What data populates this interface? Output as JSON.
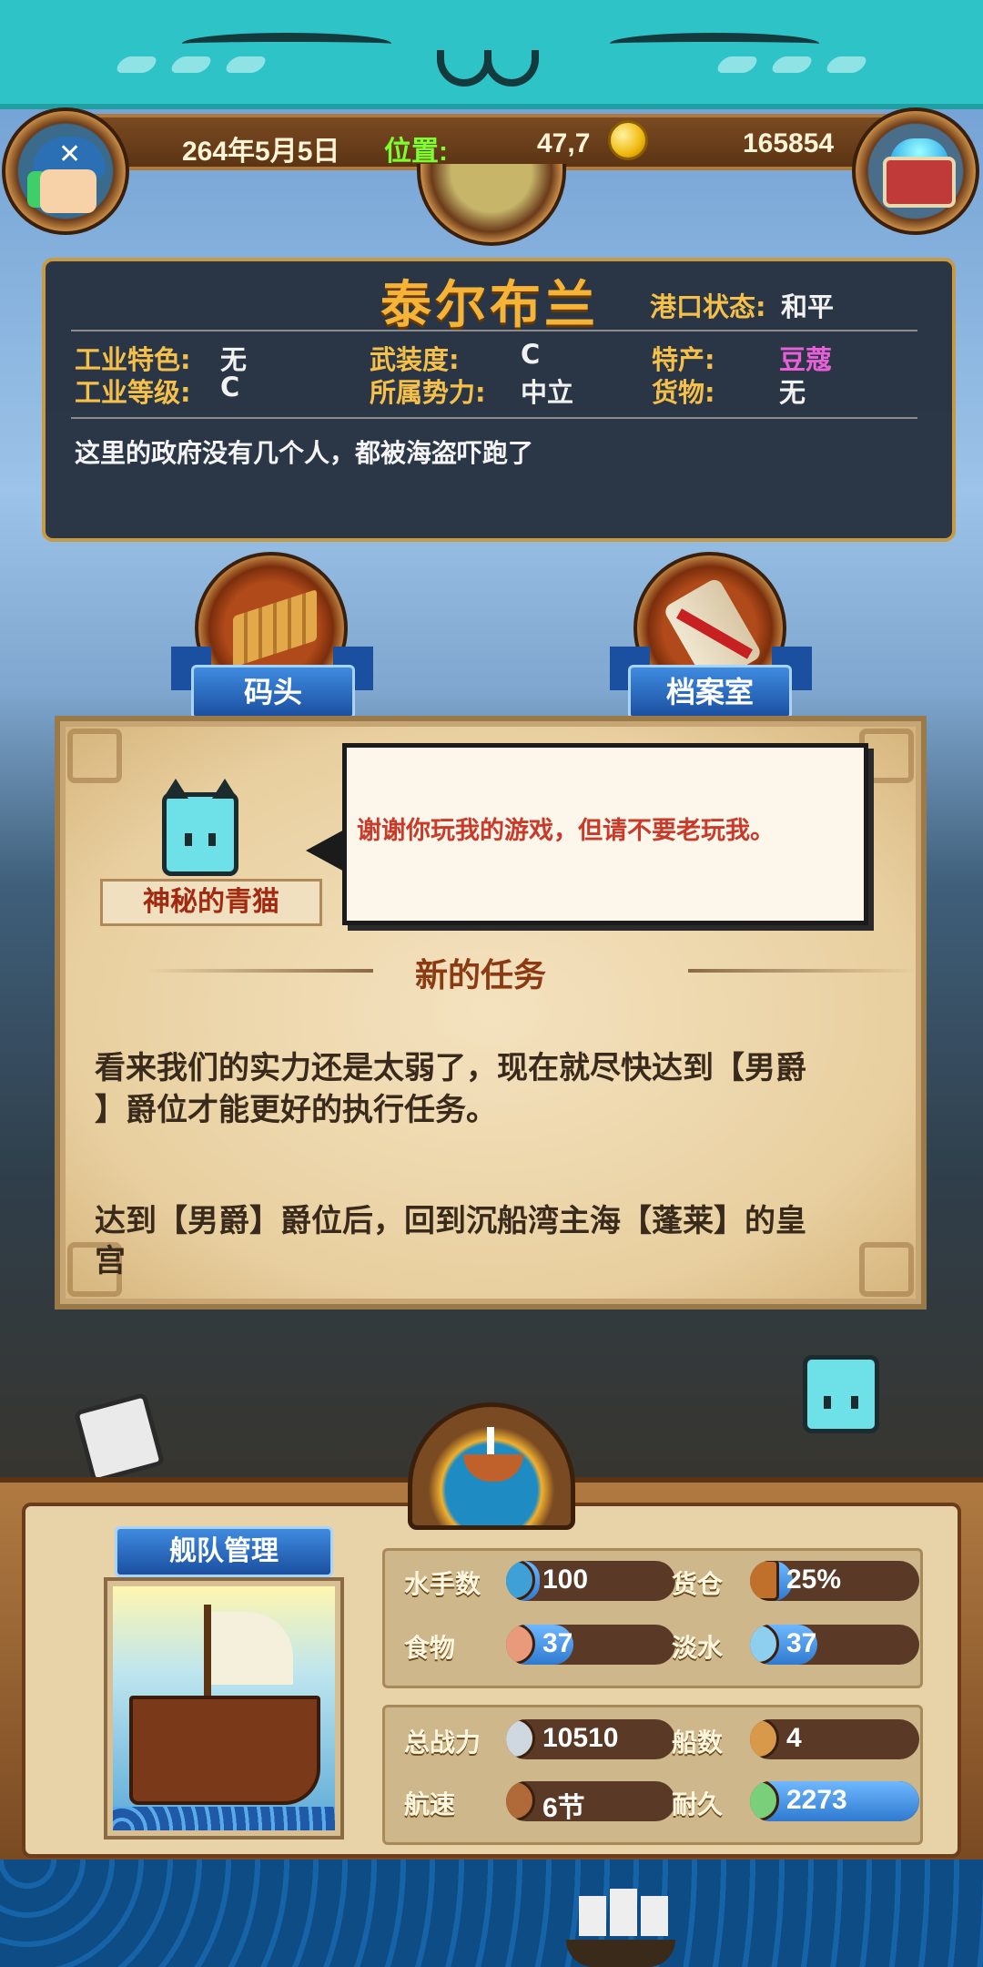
{
  "status": {
    "date": "264年5月5日",
    "position_label": "位置:",
    "position_value": "47,7",
    "gold": "165854"
  },
  "port": {
    "name": "泰尔布兰",
    "state_label": "港口状态:",
    "state_value": "和平",
    "fields": {
      "industry_feature_label": "工业特色:",
      "industry_feature_value": "无",
      "armament_label": "武装度:",
      "armament_value": "C",
      "specialty_label": "特产:",
      "specialty_value": "豆蔻",
      "industry_level_label": "工业等级:",
      "industry_level_value": "C",
      "faction_label": "所属势力:",
      "faction_value": "中立",
      "cargo_label": "货物:",
      "cargo_value": "无"
    },
    "description": "这里的政府没有几个人，都被海盗吓跑了"
  },
  "buildings": {
    "dock_label": "码头",
    "archive_label": "档案室"
  },
  "quest": {
    "npc_name": "神秘的青猫",
    "speech": "谢谢你玩我的游戏，但请不要老玩我。",
    "title": "新的任务",
    "body_line1a": "看来我们的实力还是太弱了，现在就尽快达到【男爵",
    "body_line1b": "】爵位才能更好的执行任务。",
    "body_line2a": "达到【男爵】爵位后，回到沉船湾主海【蓬莱】的皇",
    "body_line2b": "宫"
  },
  "fleet": {
    "title": "舰队管理",
    "stats": {
      "sailors_label": "水手数",
      "sailors_value": "100",
      "hold_label": "货仓",
      "hold_value": "25%",
      "food_label": "食物",
      "food_value": "37",
      "water_label": "淡水",
      "water_value": "37",
      "power_label": "总战力",
      "power_value": "10510",
      "ships_label": "船数",
      "ships_value": "4",
      "speed_label": "航速",
      "speed_value": "6节",
      "durability_label": "耐久",
      "durability_value": "2273"
    },
    "fill_fractions": {
      "sailors": 0.2,
      "hold": 0.25,
      "food": 0.4,
      "water": 0.4,
      "power": 0.0,
      "ships": 0.0,
      "speed": 0.0,
      "durability": 1.0
    }
  },
  "icons": [
    "captain-avatar-icon",
    "coin-icon",
    "treasure-chest-icon",
    "world-map-icon",
    "dock-icon",
    "scroll-icon",
    "cat-npc-icon",
    "ship-icon",
    "sailor-icon",
    "crate-icon",
    "meat-icon",
    "water-jug-icon",
    "sword-icon",
    "sail-ship-icon",
    "anchor-icon"
  ],
  "colors": {
    "accent_gold": "#f5b338",
    "specialty_pink": "#e860d8",
    "position_green": "#7cff2f",
    "ribbon_blue": "#2f6fc8",
    "speech_red": "#c83a2a",
    "banner_teal": "#2ec3c6"
  }
}
